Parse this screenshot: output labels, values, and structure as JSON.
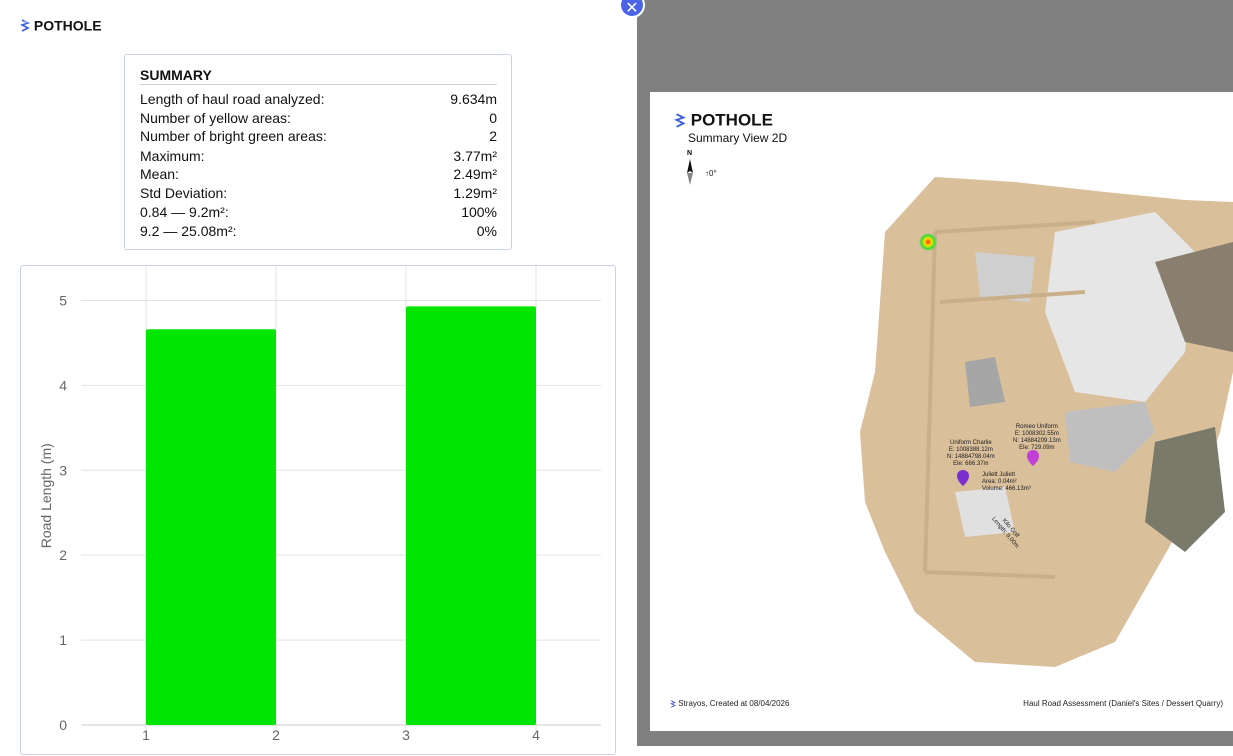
{
  "app": {
    "title": "POTHOLE"
  },
  "summary": {
    "title": "SUMMARY",
    "rows": [
      {
        "label": "Length of haul road analyzed:",
        "value": "9.634m"
      },
      {
        "label": "Number of yellow areas:",
        "value": "0"
      },
      {
        "label": "Number of bright green areas:",
        "value": "2"
      },
      {
        "label": "Maximum:",
        "value": "3.77m²"
      },
      {
        "label": "Mean:",
        "value": "2.49m²"
      },
      {
        "label": "Std Deviation:",
        "value": "1.29m²"
      },
      {
        "label": "0.84 — 9.2m²:",
        "value": "100%"
      },
      {
        "label": "9.2 — 25.08m²:",
        "value": "0%"
      }
    ]
  },
  "chart_data": {
    "type": "bar",
    "ylabel": "Road Length (m)",
    "xlabel": "",
    "x_ticks": [
      "1",
      "2",
      "3",
      "4"
    ],
    "y_ticks": [
      "0",
      "1",
      "2",
      "3",
      "4",
      "5"
    ],
    "ylim": [
      0,
      5.7
    ],
    "xlim": [
      1,
      4
    ],
    "grid": true,
    "bars": [
      {
        "x_start": 1,
        "x_end": 2,
        "value": 4.66
      },
      {
        "x_start": 3,
        "x_end": 4,
        "value": 4.93
      }
    ],
    "bar_color": "#00e600"
  },
  "close_button": {
    "label": "✕"
  },
  "report": {
    "title": "POTHOLE",
    "subtitle": "Summary View 2D",
    "north_label": "N",
    "rotation": "↑0°",
    "footer_left": "Strayos, Created at 08/04/2026",
    "footer_right": "Haul Road Assessment (Daniel's Sites / Dessert Quarry)",
    "map_labels": {
      "uniform_charlie": [
        "Uniform Charlie",
        "E: 1008388.12m",
        "N: 14884798.04m",
        "Ele: 666.37m"
      ],
      "romeo_uniform": [
        "Romeo Uniform",
        "E: 1008302.55m",
        "N: 14884209.13m",
        "Ele: 729.09m"
      ],
      "juliett_juliett": [
        "Juliett Juliett",
        "Area: 0.04m²",
        "Volume: 466.13m³"
      ],
      "kilo_golf": [
        "Kilo Golf",
        "Length: 9.00m"
      ]
    }
  },
  "colors": {
    "accent": "#4a63e8",
    "bar": "#00e600",
    "panel_bg": "#808080"
  },
  "icons": [
    "strayos-logo-icon",
    "close-icon",
    "north-arrow-icon",
    "location-pin-icon"
  ]
}
